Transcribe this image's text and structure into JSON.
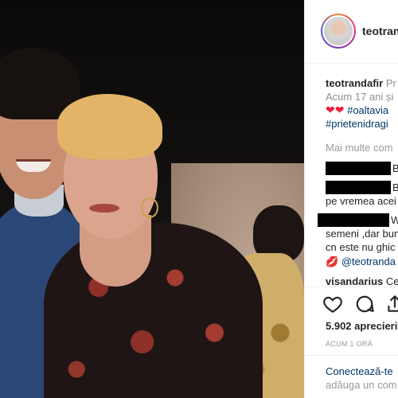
{
  "post": {
    "username": "teotrandafir"
  },
  "caption": {
    "username": "teotrandafir",
    "line1": "Pr",
    "line2": "Acum 17 ani și",
    "hashtag1": "#oaltavia",
    "hashtag2": "#prietenidragi"
  },
  "more_comments": "Mai multe com",
  "comments": [
    {
      "text": "B"
    },
    {
      "text": "B"
    },
    {
      "text": "pe vremea acei"
    },
    {
      "text": "W"
    },
    {
      "text": "semeni ,dar bun"
    },
    {
      "text": "cn este nu ghic"
    },
    {
      "mention": "@teotranda"
    },
    {
      "username": "visandarius",
      "text": "Ce"
    }
  ],
  "likes": "5.902 aprecieri",
  "timestamp": "ACUM 1 ORĂ",
  "footer": {
    "login": "Conectează-te",
    "hint": "adăuga un com"
  },
  "icons": [
    "heart-icon",
    "comment-icon",
    "share-icon"
  ],
  "colors": {
    "link": "#003569",
    "heart": "#ed1d3a",
    "text": "#262626",
    "muted": "#999999"
  }
}
